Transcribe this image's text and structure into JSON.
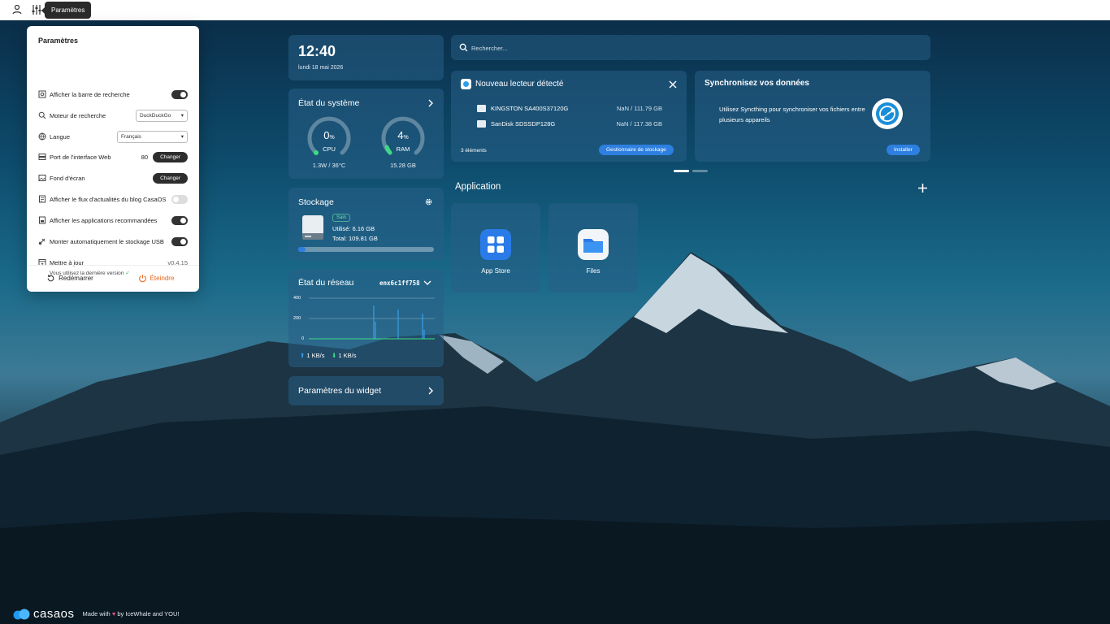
{
  "topbar": {
    "tooltip": "Paramètres"
  },
  "settings": {
    "title": "Paramètres",
    "rows": [
      {
        "label": "Afficher la barre de recherche",
        "icon": "search-bar-icon",
        "control": "toggle",
        "on": true
      },
      {
        "label": "Moteur de recherche",
        "icon": "search-icon",
        "control": "select",
        "value": "DuckDuckGo"
      },
      {
        "label": "Langue",
        "icon": "globe-icon",
        "control": "select",
        "value": "Français"
      },
      {
        "label": "Port de l'interface Web",
        "icon": "server-icon",
        "control": "button",
        "port": "80",
        "button": "Changer"
      },
      {
        "label": "Fond d'écran",
        "icon": "image-icon",
        "control": "button",
        "button": "Changer"
      },
      {
        "label": "Afficher le flux d'actualités du blog CasaOS",
        "icon": "news-icon",
        "control": "toggle",
        "on": false
      },
      {
        "label": "Afficher les applications recommandées",
        "icon": "apps-icon",
        "control": "toggle",
        "on": true
      },
      {
        "label": "Monter automatiquement le stockage USB",
        "icon": "usb-icon",
        "control": "toggle",
        "on": true
      },
      {
        "label": "Mettre à jour",
        "icon": "update-icon",
        "control": "version",
        "version": "v0.4.15"
      }
    ],
    "update_note": "Vous utilisez la dernière version",
    "restart": "Redémarrer",
    "shutdown": "Éteindre"
  },
  "clock": {
    "time": "12:40",
    "date": "lundi 18 mai 2026"
  },
  "system": {
    "title": "État du système",
    "cpu": {
      "value": "0",
      "unit": "%",
      "label": "CPU",
      "detail": "1.3W / 36°C",
      "percent": 0
    },
    "ram": {
      "value": "4",
      "unit": "%",
      "label": "RAM",
      "detail": "15.28 GB",
      "percent": 4
    }
  },
  "storage": {
    "title": "Stockage",
    "badge": "Sain",
    "used": "Utilisé: 6.16 GB",
    "total": "Total: 109.81 GB",
    "percent": 5.6
  },
  "network": {
    "title": "État du réseau",
    "iface": "enx6c1ff758",
    "ticks": [
      "400",
      "200",
      "0"
    ],
    "up": "1 KB/s",
    "down": "1 KB/s"
  },
  "widget_settings": {
    "label": "Paramètres du widget"
  },
  "search": {
    "placeholder": "Rechercher..."
  },
  "new_drive": {
    "title": "Nouveau lecteur détecté",
    "drives": [
      {
        "name": "KINGSTON SA400S37120G",
        "size": "NaN / 111.79 GB"
      },
      {
        "name": "SanDisk SDSSDP128G",
        "size": "NaN / 117.38 GB"
      }
    ],
    "count": "3 éléments",
    "button": "Gestionnaire de stockage"
  },
  "sync": {
    "title": "Synchronisez vos données",
    "text": "Utilisez Syncthing pour synchroniser vos fichiers entre plusieurs appareils",
    "button": "Installer"
  },
  "apps": {
    "title": "Application",
    "items": [
      {
        "name": "App Store",
        "icon": "app-store-icon"
      },
      {
        "name": "Files",
        "icon": "files-icon"
      }
    ]
  },
  "footer": {
    "logo": "casaos",
    "made": "Made with",
    "by": "by IceWhale and YOU!"
  },
  "colors": {
    "accent": "#2d7fe0",
    "gauge": "#3ddc84",
    "toggle_on": "#333333"
  }
}
